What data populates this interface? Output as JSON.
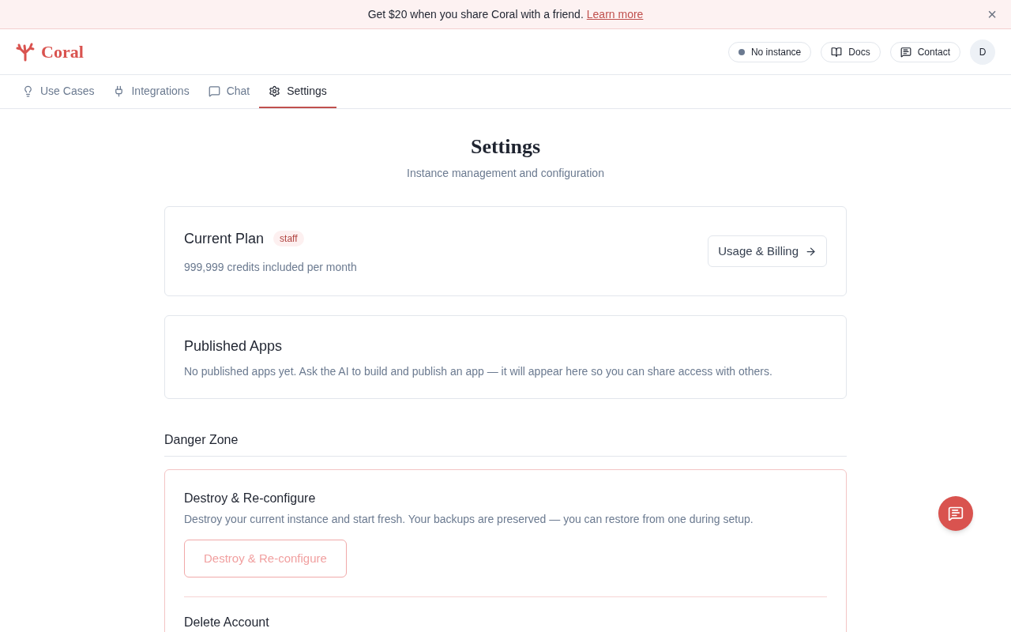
{
  "banner": {
    "text": "Get $20 when you share Coral with a friend.",
    "link": "Learn more",
    "close": "×"
  },
  "header": {
    "logo": "Coral",
    "instance": {
      "label": "No instance",
      "color": "#6b7a90"
    },
    "docs": "Docs",
    "contact": "Contact",
    "avatar": "D"
  },
  "tabs": [
    {
      "label": "Use Cases",
      "kind": "bulb",
      "selected": false
    },
    {
      "label": "Integrations",
      "kind": "plug",
      "selected": false
    },
    {
      "label": "Chat",
      "kind": "chat",
      "selected": false
    },
    {
      "label": "Settings",
      "kind": "gear",
      "selected": true
    }
  ],
  "page": {
    "title": "Settings",
    "subtitle": "Instance management and configuration"
  },
  "plan": {
    "title": "Current Plan",
    "badge": "staff",
    "credits": "999,999 credits included per month",
    "button": "Usage & Billing"
  },
  "apps": {
    "title": "Published Apps",
    "text": "No published apps yet. Ask the AI to build and publish an app — it will appear here so you can share access with others."
  },
  "danger": {
    "title": "Danger Zone",
    "sections": [
      {
        "title": "Destroy & Re-configure",
        "text": "Destroy your current instance and start fresh. Your backups are preserved — you can restore from one during setup.",
        "button": "Destroy & Re-configure",
        "disabled": true
      },
      {
        "title": "Delete Account"
      }
    ]
  }
}
